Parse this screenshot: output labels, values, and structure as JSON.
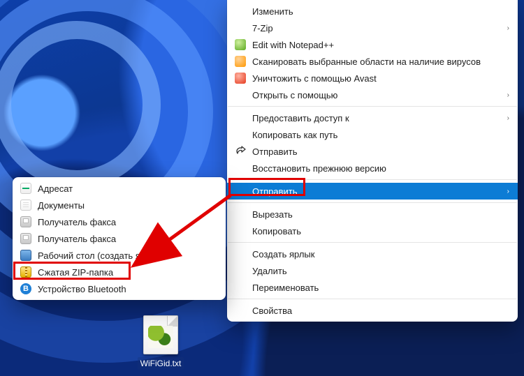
{
  "main_menu": {
    "groups": [
      [
        {
          "label": "Изменить",
          "icon": null,
          "submenu": false
        },
        {
          "label": "7-Zip",
          "icon": null,
          "submenu": true
        },
        {
          "label": "Edit with Notepad++",
          "icon": "green",
          "submenu": false
        },
        {
          "label": "Сканировать выбранные области на наличие вирусов",
          "icon": "orange",
          "submenu": false
        },
        {
          "label": "Уничтожить с помощью Avast",
          "icon": "red",
          "submenu": false
        },
        {
          "label": "Открыть с помощью",
          "icon": null,
          "submenu": true
        }
      ],
      [
        {
          "label": "Предоставить доступ к",
          "icon": null,
          "submenu": true
        },
        {
          "label": "Копировать как путь",
          "icon": null,
          "submenu": false
        },
        {
          "label": "Отправить",
          "icon": "share",
          "submenu": false
        },
        {
          "label": "Восстановить прежнюю версию",
          "icon": null,
          "submenu": false
        }
      ],
      [
        {
          "label": "Отправить",
          "icon": null,
          "submenu": true,
          "selected": true
        }
      ],
      [
        {
          "label": "Вырезать",
          "icon": null,
          "submenu": false
        },
        {
          "label": "Копировать",
          "icon": null,
          "submenu": false
        }
      ],
      [
        {
          "label": "Создать ярлык",
          "icon": null,
          "submenu": false
        },
        {
          "label": "Удалить",
          "icon": null,
          "submenu": false
        },
        {
          "label": "Переименовать",
          "icon": null,
          "submenu": false
        }
      ],
      [
        {
          "label": "Свойства",
          "icon": null,
          "submenu": false
        }
      ]
    ]
  },
  "sub_menu": {
    "items": [
      {
        "label": "Адресат",
        "icon": "card"
      },
      {
        "label": "Документы",
        "icon": "doc"
      },
      {
        "label": "Получатель факса",
        "icon": "printer"
      },
      {
        "label": "Получатель факса",
        "icon": "printer"
      },
      {
        "label": "Рабочий стол (создать ярлык)",
        "icon": "desk"
      },
      {
        "label": "Сжатая ZIP-папка",
        "icon": "zip",
        "highlighted": true
      },
      {
        "label": "Устройство Bluetooth",
        "icon": "bt"
      }
    ]
  },
  "desktop_file": {
    "name": "WiFiGid.txt"
  }
}
